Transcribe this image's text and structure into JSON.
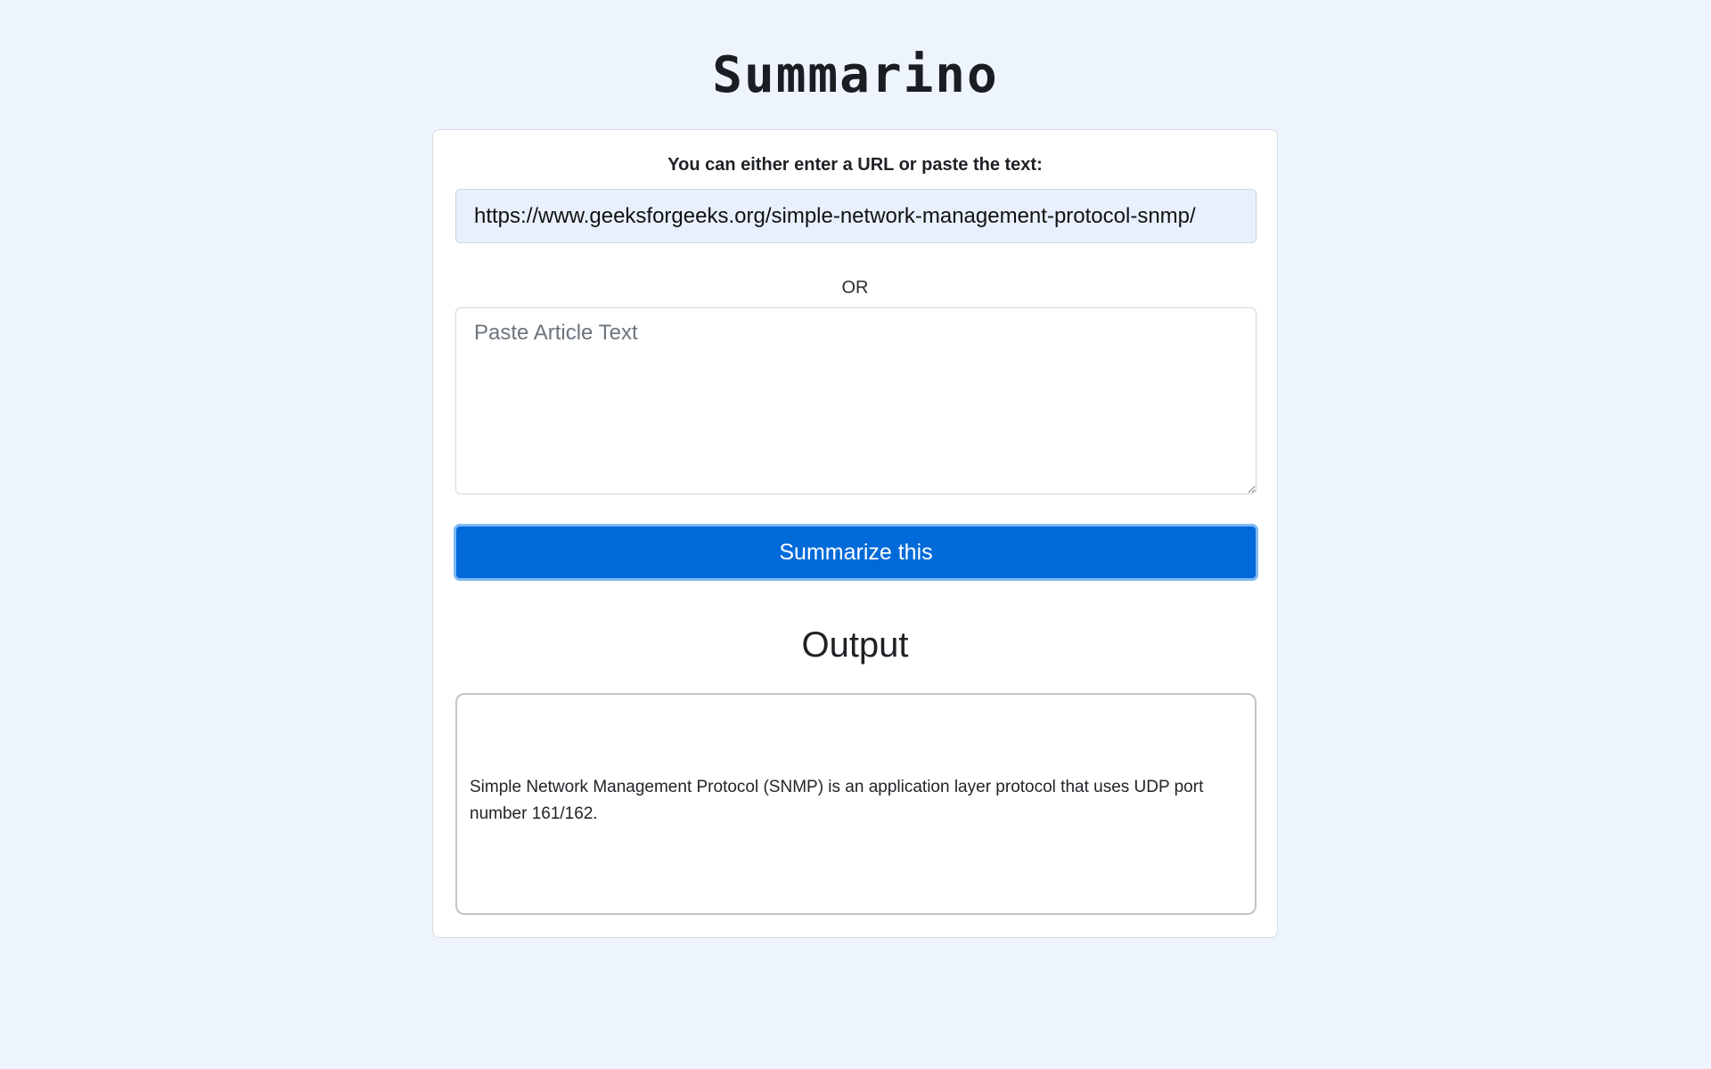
{
  "app": {
    "title": "Summarino"
  },
  "form": {
    "instructions": "You can either enter a URL or paste the text:",
    "url_input": {
      "value": "https://www.geeksforgeeks.org/simple-network-management-protocol-snmp/",
      "placeholder": ""
    },
    "or_label": "OR",
    "text_input": {
      "value": "",
      "placeholder": "Paste Article Text"
    },
    "submit_label": "Summarize this"
  },
  "output": {
    "heading": "Output",
    "text": "Simple Network Management Protocol (SNMP) is an application layer protocol that uses UDP port number 161/162."
  },
  "colors": {
    "background": "#eef4fe",
    "button": "#006ad9",
    "url_input_bg": "#e8f0fe"
  }
}
